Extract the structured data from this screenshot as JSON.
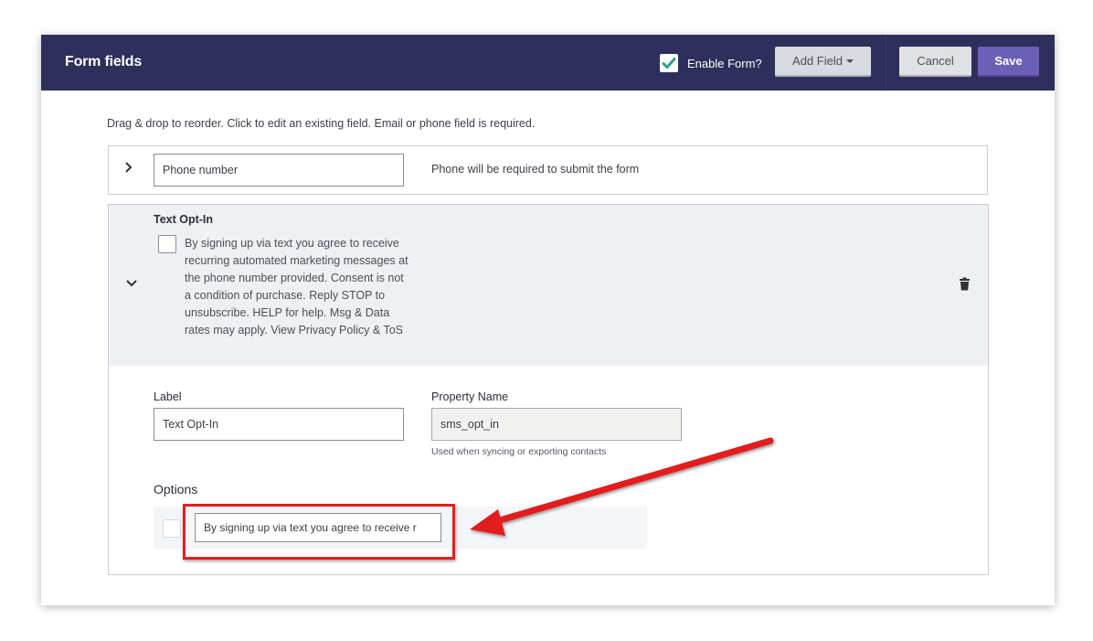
{
  "header": {
    "title": "Form fields",
    "enable_form_label": "Enable Form?",
    "enable_form_checked": true,
    "add_field_label": "Add Field",
    "cancel_label": "Cancel",
    "save_label": "Save"
  },
  "helper_text": "Drag & drop to reorder. Click to edit an existing field. Email or phone field is required.",
  "phone_field": {
    "value": "Phone number",
    "note": "Phone will be required to submit the form"
  },
  "opt_in": {
    "title": "Text Opt-In",
    "text": "By signing up via text you agree to receive recurring automated marketing messages at the phone number provided. Consent is not a condition of purchase. Reply STOP to unsubscribe. HELP for help. Msg & Data rates may apply. View Privacy Policy & ToS"
  },
  "editor": {
    "label_title": "Label",
    "label_value": "Text Opt-In",
    "property_title": "Property Name",
    "property_value": "sms_opt_in",
    "property_note": "Used when syncing or exporting contacts",
    "options_title": "Options",
    "option_value": "By signing up via text you agree to receive r"
  },
  "colors": {
    "header_bg": "#2e2f5b",
    "save_bg": "#6b5fb8",
    "check_green": "#2a9d8f",
    "annotation_red": "#e31e1e"
  },
  "icons": {
    "enable": "checkmark-icon",
    "expand": "chevron-right-icon",
    "collapse": "chevron-down-icon",
    "delete": "trash-icon",
    "dropdown": "caret-down-icon"
  }
}
